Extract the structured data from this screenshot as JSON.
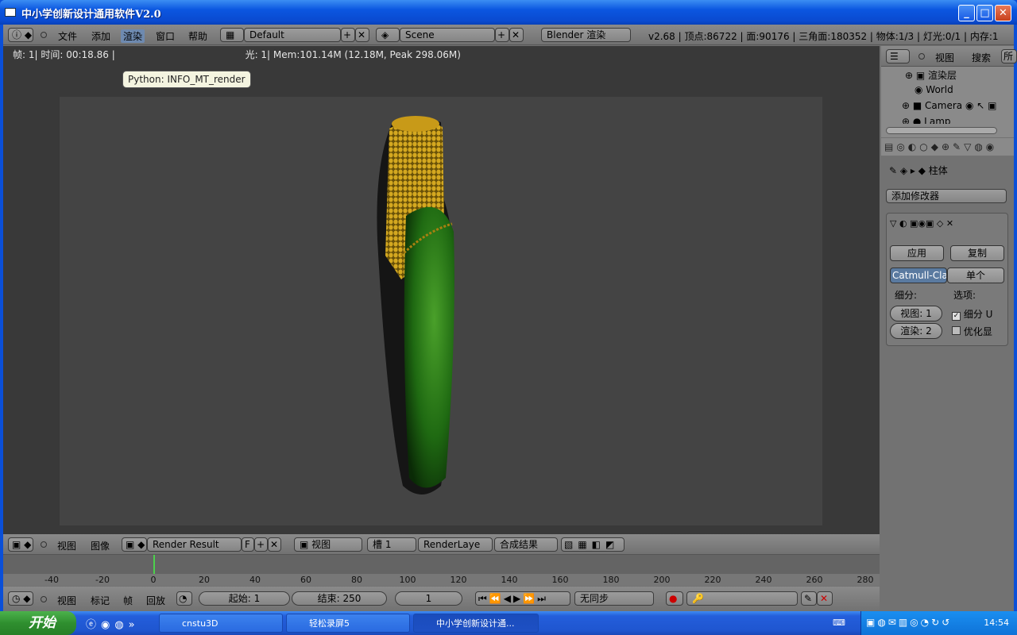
{
  "window": {
    "title": "中小学创新设计通用软件V2.0"
  },
  "info_header": {
    "menus": [
      "文件",
      "添加",
      "渲染",
      "窗口",
      "帮助"
    ],
    "layout_name": "Default",
    "scene_name": "Scene",
    "engine": "Blender 渲染",
    "stats": "v2.68 | 顶点:86722 | 面:90176 | 三角面:180352 | 物体:1/3 | 灯光:0/1 | 内存:1"
  },
  "viewport": {
    "info_left": "帧: 1| 时间: 00:18.86 |",
    "info_right": "光: 1| Mem:101.14M (12.18M, Peak 298.06M)",
    "tooltip": "Python: INFO_MT_render"
  },
  "outliner": {
    "menus": [
      "视图",
      "搜索",
      "所"
    ],
    "items": [
      "渲染层",
      "World",
      "Camera",
      "Lamp"
    ]
  },
  "properties": {
    "object_name": "柱体",
    "add_modifier": "添加修改器",
    "apply_label": "应用",
    "copy_label": "复制",
    "subdiv_type": "Catmull-Clark",
    "simple_label": "单个",
    "subdiv_label": "细分:",
    "options_label": "选项:",
    "view_level": "视图: 1",
    "render_level": "渲染: 2",
    "opt_subdiv_uv": "细分 U",
    "opt_optimal": "优化显",
    "subdiv_uv_checked": true,
    "optimal_checked": false
  },
  "image_header": {
    "menus": [
      "视图",
      "图像"
    ],
    "image_name": "Render Result",
    "f_label": "F",
    "view_select": "视图",
    "slot": "槽 1",
    "render_layer": "RenderLaye",
    "pass": "合成结果"
  },
  "timeline": {
    "ticks": [
      "-40",
      "-20",
      "0",
      "20",
      "40",
      "60",
      "80",
      "100",
      "120",
      "140",
      "160",
      "180",
      "200",
      "220",
      "240",
      "260",
      "280"
    ],
    "current_frame": 1
  },
  "timeline_header": {
    "menus": [
      "视图",
      "标记",
      "帧",
      "回放"
    ],
    "start": "起始: 1",
    "end": "结束: 250",
    "current": "1",
    "sync": "无同步"
  },
  "taskbar": {
    "start_label": "开始",
    "tasks": [
      "cnstu3D",
      "轻松录屏5",
      "中小学创新设计通..."
    ],
    "clock": "14:54"
  }
}
